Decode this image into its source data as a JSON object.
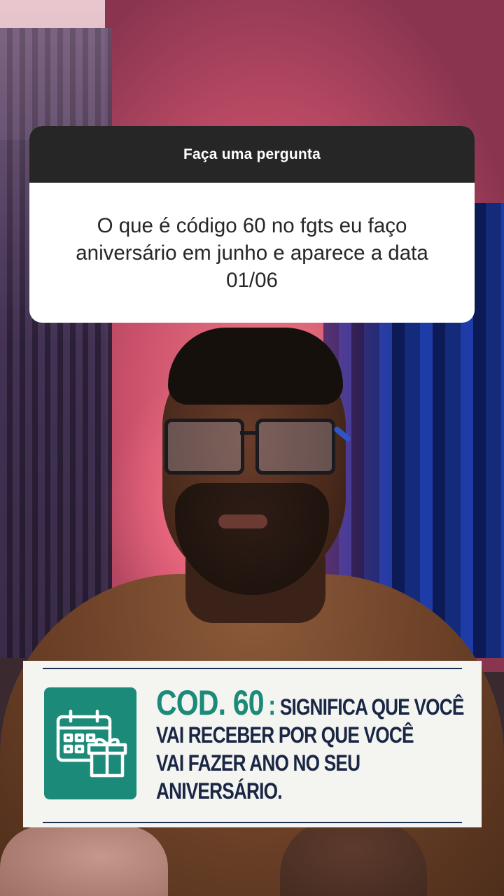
{
  "question_sticker": {
    "header": "Faça uma pergunta",
    "question": "O que é código 60 no fgts eu faço aniversário em junho e aparece a data 01/06"
  },
  "info_banner": {
    "code_label": "COD. 60",
    "colon": ":",
    "line1": "SIGNIFICA QUE VOCÊ",
    "line2": "VAI RECEBER POR QUE VOCÊ",
    "line3": "VAI FAZER ANO NO SEU",
    "line4": "ANIVERSÁRIO.",
    "icon": "calendar-gift-icon",
    "accent_color": "#1b8a78",
    "text_color": "#1a2744"
  }
}
